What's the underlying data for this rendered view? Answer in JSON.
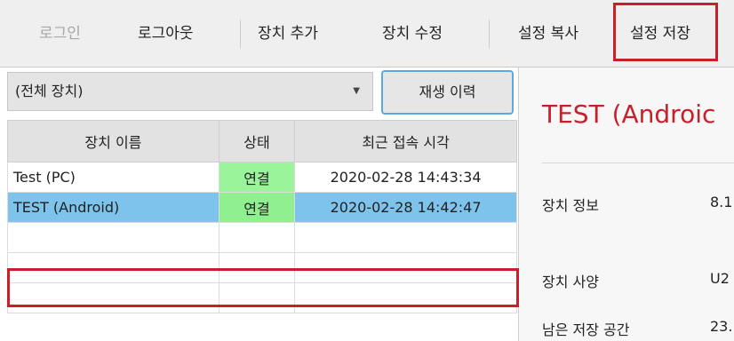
{
  "toolbar": {
    "login": "로그인",
    "logout": "로그아웃",
    "add_device": "장치 추가",
    "edit_device": "장치 수정",
    "copy_settings": "설정 복사",
    "save_settings": "설정 저장"
  },
  "device_filter": {
    "selected": "(전체 장치)"
  },
  "history_button": "재생 이력",
  "table": {
    "headers": [
      "장치 이름",
      "상태",
      "최근 접속 시각"
    ],
    "rows": [
      {
        "name": "Test (PC)",
        "status": "연결",
        "last_access": "2020-02-28 14:43:34"
      },
      {
        "name": "TEST (Android)",
        "status": "연결",
        "last_access": "2020-02-28 14:42:47"
      }
    ]
  },
  "detail": {
    "title": "TEST (Androic",
    "rows": [
      {
        "label": "장치 정보",
        "value": "8.1"
      },
      {
        "label": "장치 사양",
        "value": "U2"
      },
      {
        "label": "남은 저장 공간",
        "value": "23."
      }
    ]
  },
  "colors": {
    "highlight": "#c8202a",
    "connected": "#9af49a",
    "selected_row": "#7ec3ec"
  }
}
